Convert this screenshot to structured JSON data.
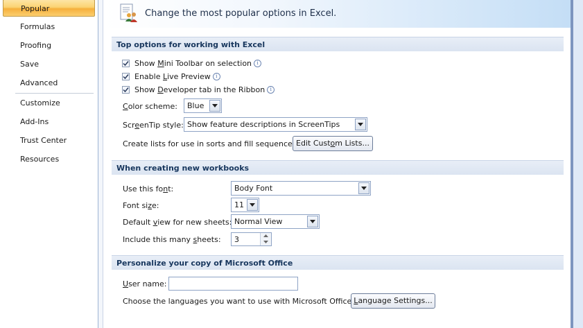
{
  "nav": {
    "items": [
      {
        "label": "Popular",
        "selected": true
      },
      {
        "label": "Formulas"
      },
      {
        "label": "Proofing"
      },
      {
        "label": "Save"
      },
      {
        "label": "Advanced"
      },
      {
        "label": "Customize"
      },
      {
        "label": "Add-Ins"
      },
      {
        "label": "Trust Center"
      },
      {
        "label": "Resources"
      }
    ]
  },
  "banner": {
    "text": "Change the most popular options in Excel."
  },
  "top_options": {
    "header": "Top options for working with Excel",
    "mini_toolbar": {
      "label": "Show Mini Toolbar on selection",
      "checked": true
    },
    "live_preview": {
      "label": "Enable Live Preview",
      "checked": true
    },
    "developer_tab": {
      "label": "Show Developer tab in the Ribbon",
      "checked": true
    },
    "color_scheme": {
      "label": "Color scheme:",
      "value": "Blue"
    },
    "screentip": {
      "label": "ScreenTip style:",
      "value": "Show feature descriptions in ScreenTips"
    },
    "custom_lists": {
      "label": "Create lists for use in sorts and fill sequences:",
      "button": "Edit Custom Lists..."
    }
  },
  "new_workbooks": {
    "header": "When creating new workbooks",
    "font": {
      "label": "Use this font:",
      "value": "Body Font"
    },
    "font_size": {
      "label": "Font size:",
      "value": "11"
    },
    "default_view": {
      "label": "Default view for new sheets:",
      "value": "Normal View"
    },
    "sheets": {
      "label": "Include this many sheets:",
      "value": "3"
    }
  },
  "personalize": {
    "header": "Personalize your copy of Microsoft Office",
    "user_name": {
      "label": "User name:",
      "value": ""
    },
    "languages": {
      "label": "Choose the languages you want to use with Microsoft Office:",
      "button": "Language Settings..."
    }
  },
  "colors": {
    "accent": "#17365d",
    "selected_nav": "#fbd373",
    "section_bg": "#dbe4f1"
  },
  "icons": {
    "banner": "options-people-icon",
    "info": "info-icon",
    "dropdown": "chevron-down-icon"
  }
}
